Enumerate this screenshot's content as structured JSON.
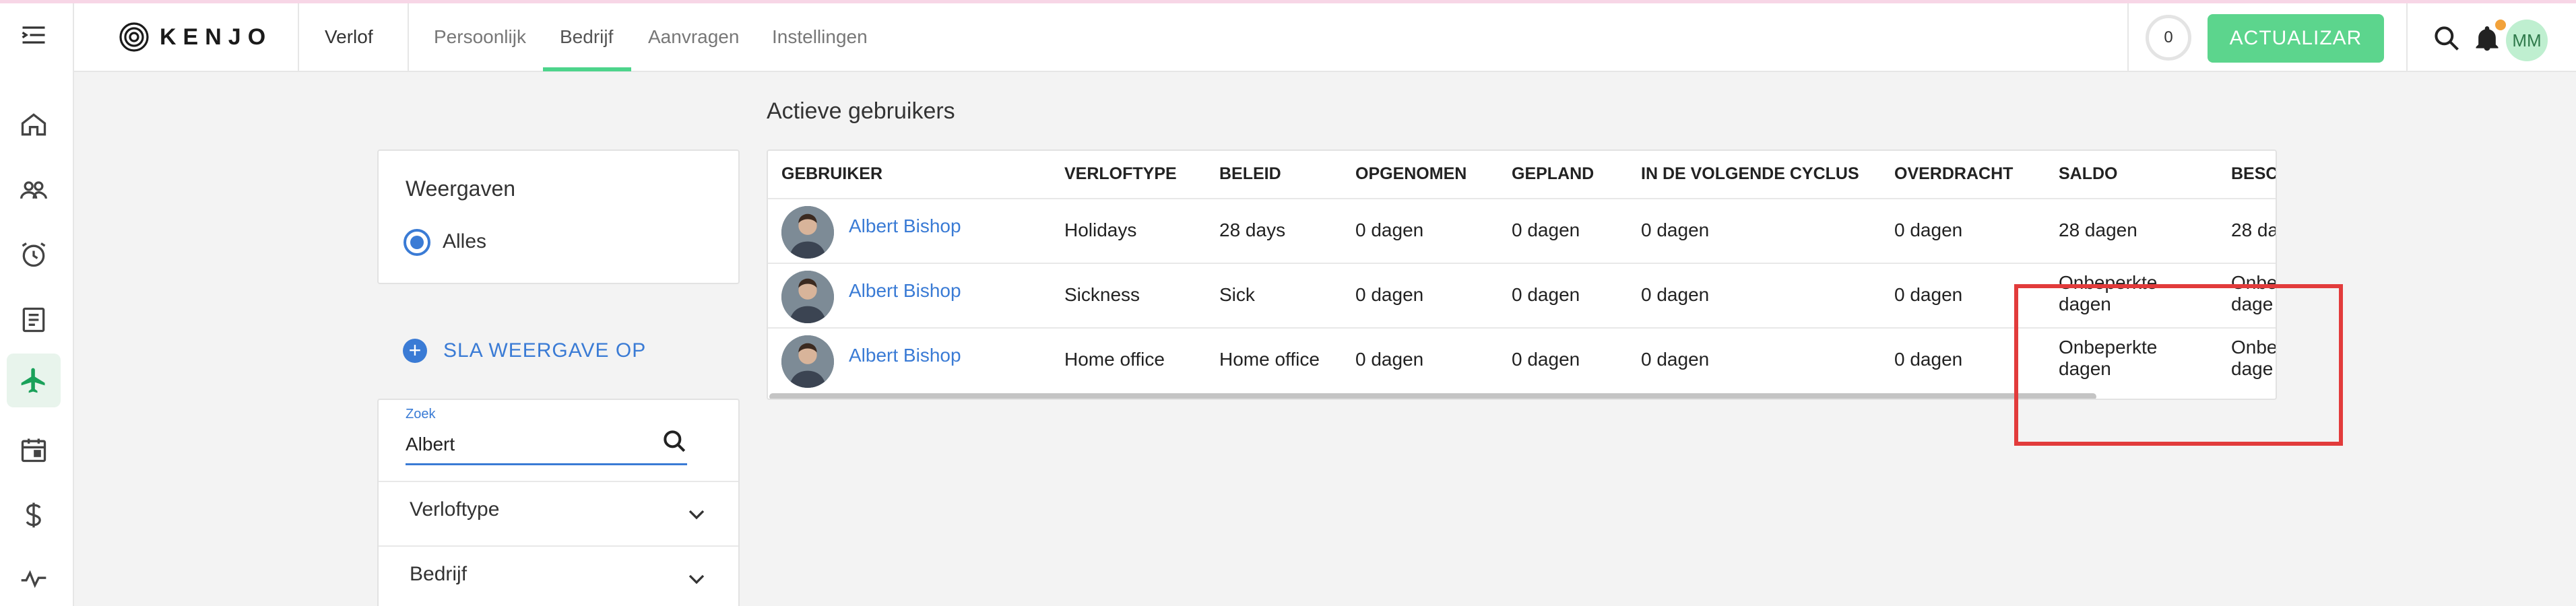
{
  "topbar": {
    "logo_text": "KENJO",
    "module": "Verlof",
    "tabs": [
      {
        "label": "Persoonlijk"
      },
      {
        "label": "Bedrijf"
      },
      {
        "label": "Aanvragen"
      },
      {
        "label": "Instellingen"
      }
    ],
    "active_tab": "Bedrijf",
    "counter": "0",
    "update_button": "ACTUALIZAR",
    "user_initials": "MM"
  },
  "sidebar": {
    "items": [
      {
        "icon": "home-icon"
      },
      {
        "icon": "people-icon"
      },
      {
        "icon": "alarm-clock-icon"
      },
      {
        "icon": "document-icon"
      },
      {
        "icon": "airplane-icon",
        "active": true
      },
      {
        "icon": "calendar-icon"
      },
      {
        "icon": "dollar-icon"
      },
      {
        "icon": "pulse-icon"
      }
    ]
  },
  "views": {
    "title": "Weergaven",
    "options": [
      {
        "label": "Alles",
        "selected": true
      }
    ],
    "save_view_label": "SLA WEERGAVE OP"
  },
  "search": {
    "label": "Zoek",
    "value": "Albert"
  },
  "filters": [
    {
      "label": "Verloftype"
    },
    {
      "label": "Bedrijf"
    }
  ],
  "table": {
    "title": "Actieve gebruikers",
    "columns": [
      "GEBRUIKER",
      "VERLOFTYPE",
      "BELEID",
      "OPGENOMEN",
      "GEPLAND",
      "IN DE VOLGENDE CYCLUS",
      "OVERDRACHT",
      "SALDO",
      "BESCI"
    ],
    "rows": [
      {
        "user": "Albert Bishop",
        "type": "Holidays",
        "policy": "28 days",
        "taken": "0 dagen",
        "planned": "0 dagen",
        "next_cycle": "0 dagen",
        "carryover": "0 dagen",
        "balance": "28 dagen",
        "available": "28 da"
      },
      {
        "user": "Albert Bishop",
        "type": "Sickness",
        "policy": "Sick",
        "taken": "0 dagen",
        "planned": "0 dagen",
        "next_cycle": "0 dagen",
        "carryover": "0 dagen",
        "balance": "Onbeperkte dagen",
        "available": "Onbe dage"
      },
      {
        "user": "Albert Bishop",
        "type": "Home office",
        "policy": "Home office",
        "taken": "0 dagen",
        "planned": "0 dagen",
        "next_cycle": "0 dagen",
        "carryover": "0 dagen",
        "balance": "Onbeperkte dagen",
        "available": "Onbe dage"
      }
    ]
  },
  "colors": {
    "accent_green": "#5cd58d",
    "link_blue": "#3a7bd5",
    "highlight_red": "#e23b3b"
  }
}
